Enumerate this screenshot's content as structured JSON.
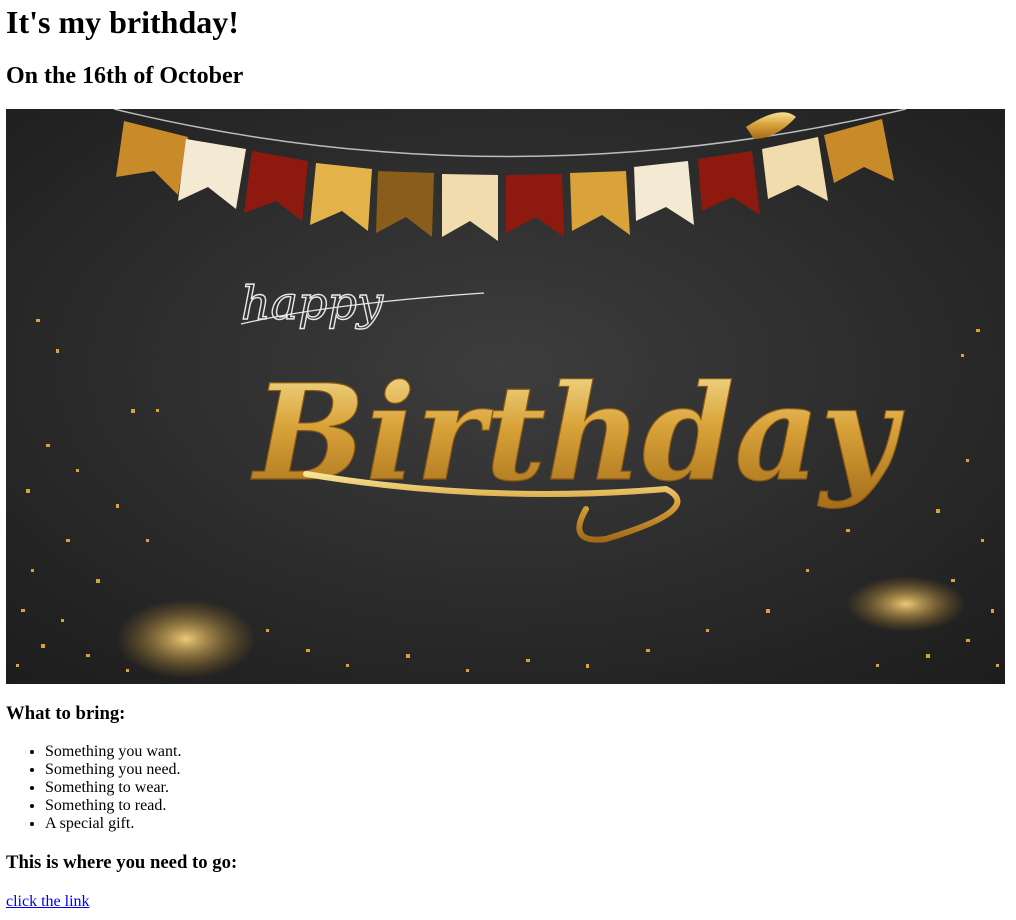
{
  "header": {
    "title": "It's my brithday!",
    "subtitle": "On the 16th of October"
  },
  "banner": {
    "script_word": "happy",
    "main_word": "Birthday",
    "colors": {
      "background": "#2c2c2c",
      "gold": "#d9a33a",
      "gold_light": "#f3d98a",
      "red": "#8e1a0f",
      "cream": "#f4ead4"
    }
  },
  "bring": {
    "heading": "What to bring:",
    "items": [
      "Something you want.",
      "Something you need.",
      "Something to wear.",
      "Something to read.",
      "A special gift."
    ]
  },
  "directions": {
    "heading": "This is where you need to go:",
    "link_text": "click the link"
  }
}
